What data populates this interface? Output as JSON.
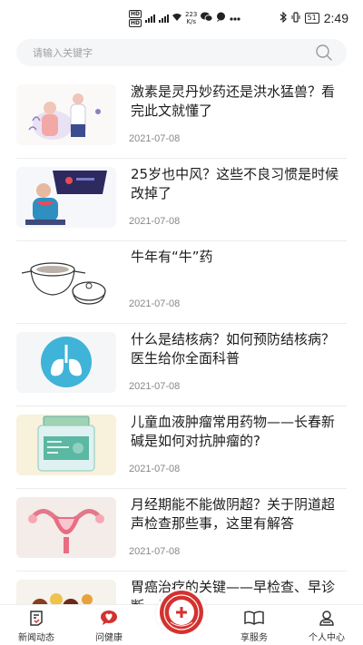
{
  "status_bar": {
    "badge_top": "HD",
    "badge_bottom": "HD",
    "net_speed_value": "223",
    "net_speed_unit": "K/s",
    "battery": "51",
    "time": "2:49"
  },
  "search": {
    "placeholder": "请输入关键字"
  },
  "articles": [
    {
      "title": "激素是灵丹妙药还是洪水猛兽？看完此文就懂了",
      "date": "2021-07-08",
      "thumb_icon": "doctor-patient-illustration"
    },
    {
      "title": "25岁也中风？这些不良习惯是时候改掉了",
      "date": "2021-07-08",
      "thumb_icon": "sick-person-illustration"
    },
    {
      "title": "牛年有“牛”药",
      "date": "2021-07-08",
      "thumb_icon": "herbal-pot-illustration"
    },
    {
      "title": "什么是结核病？如何预防结核病？医生给你全面科普",
      "date": "2021-07-08",
      "thumb_icon": "lungs-illustration"
    },
    {
      "title": "儿童血液肿瘤常用药物——长春新碱是如何对抗肿瘤的?",
      "date": "2021-07-08",
      "thumb_icon": "medicine-bottle-illustration"
    },
    {
      "title": "月经期能不能做阴超？关于阴道超声检查那些事，这里有解答",
      "date": "2021-07-08",
      "thumb_icon": "uterus-illustration"
    },
    {
      "title": "胃癌治疗的关键——早检查、早诊断、早治疗",
      "date": "",
      "thumb_icon": "stomach-illustration"
    }
  ],
  "tab_bar": {
    "tabs": [
      {
        "label": "新闻动态",
        "icon": "news-icon"
      },
      {
        "label": "问健康",
        "icon": "heart-chat-icon"
      },
      {
        "label": "",
        "icon": "hospital-seal-logo"
      },
      {
        "label": "享服务",
        "icon": "book-icon"
      },
      {
        "label": "个人中心",
        "icon": "person-icon"
      }
    ]
  },
  "colors": {
    "accent": "#d4322f",
    "text": "#1c1c1c",
    "date": "#888888",
    "search_bg": "#f5f6f8"
  }
}
